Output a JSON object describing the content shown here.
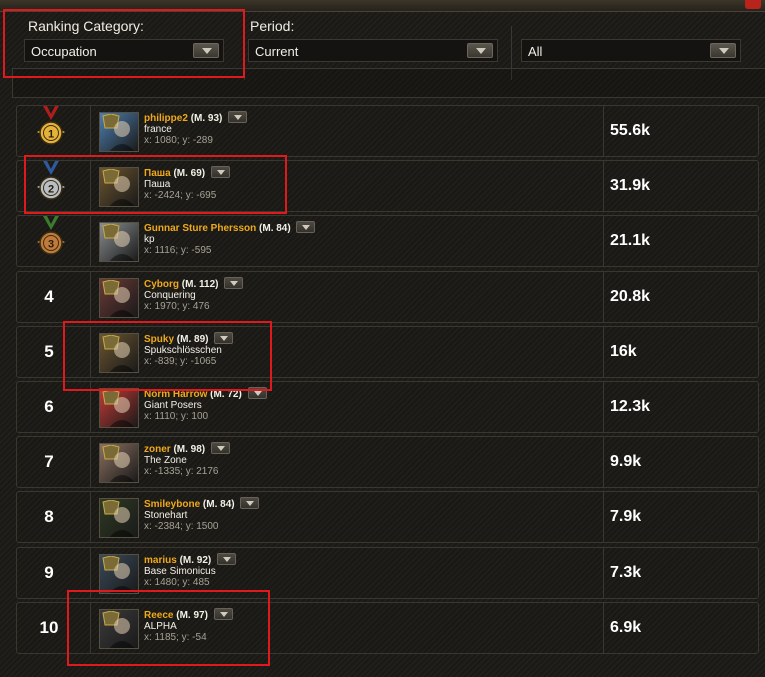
{
  "filters": {
    "ranking_category": {
      "label": "Ranking Category:",
      "value": "Occupation"
    },
    "period": {
      "label": "Period:",
      "value": "Current"
    },
    "scope": {
      "value": "All"
    }
  },
  "rows": [
    {
      "rank": "1",
      "medal": "gold",
      "name": "philippe2",
      "level": "(M. 93)",
      "alliance": "france",
      "coords": "x: 1080; y: -289",
      "score": "55.6k",
      "avatar_color": "#4d7fb0"
    },
    {
      "rank": "2",
      "medal": "silver",
      "name": "Паша",
      "level": "(M. 69)",
      "alliance": "Паша",
      "coords": "x: -2424; y: -695",
      "score": "31.9k",
      "avatar_color": "#6b5530"
    },
    {
      "rank": "3",
      "medal": "bronze",
      "name": "Gunnar Sture Phersson",
      "level": "(M. 84)",
      "alliance": "kp",
      "coords": "x: 1116; y: -595",
      "score": "21.1k",
      "avatar_color": "#8a8e90"
    },
    {
      "rank": "4",
      "medal": "",
      "name": "Cyborg",
      "level": "(M. 112)",
      "alliance": "Conquering",
      "coords": "x: 1970; y: 476",
      "score": "20.8k",
      "avatar_color": "#6a3a36"
    },
    {
      "rank": "5",
      "medal": "",
      "name": "Spuky",
      "level": "(M. 89)",
      "alliance": "Spukschlösschen",
      "coords": "x: -839; y: -1065",
      "score": "16k",
      "avatar_color": "#6b5530"
    },
    {
      "rank": "6",
      "medal": "",
      "name": "Norm Harrow",
      "level": "(M. 72)",
      "alliance": "Giant Posers",
      "coords": "x: 1110; y: 100",
      "score": "12.3k",
      "avatar_color": "#c23a36"
    },
    {
      "rank": "7",
      "medal": "",
      "name": "zoner",
      "level": "(M. 98)",
      "alliance": "The Zone",
      "coords": "x: -1335; y: 2176",
      "score": "9.9k",
      "avatar_color": "#8a7060"
    },
    {
      "rank": "8",
      "medal": "",
      "name": "Smileybone",
      "level": "(M. 84)",
      "alliance": "Stonehart",
      "coords": "x: -2384; y: 1500",
      "score": "7.9k",
      "avatar_color": "#2e3a22"
    },
    {
      "rank": "9",
      "medal": "",
      "name": "marius",
      "level": "(M. 92)",
      "alliance": "Base Simonicus",
      "coords": "x: 1480; y: 485",
      "score": "7.3k",
      "avatar_color": "#3a4a5a"
    },
    {
      "rank": "10",
      "medal": "",
      "name": "Reece",
      "level": "(M. 97)",
      "alliance": "ALPHA",
      "coords": "x: 1185; y: -54",
      "score": "6.9k",
      "avatar_color": "#3b3b3b"
    }
  ],
  "highlight_color": "#e0191c"
}
